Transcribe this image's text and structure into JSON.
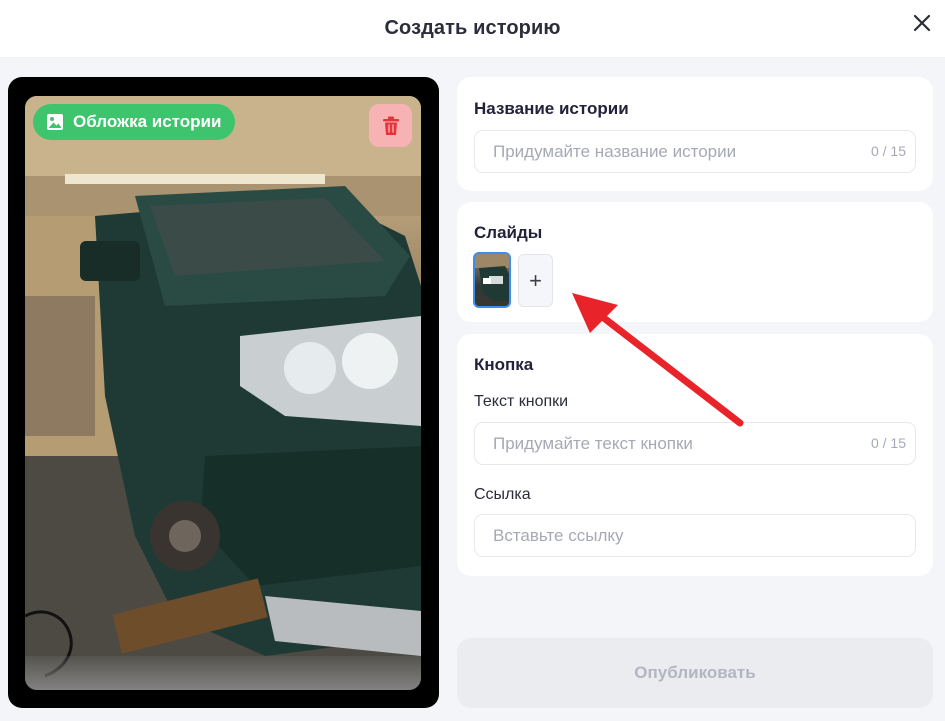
{
  "header": {
    "title": "Создать историю",
    "close_icon": "close-icon"
  },
  "preview": {
    "cover_label": "Обложка истории",
    "cover_icon": "image-icon",
    "delete_icon": "trash-icon",
    "accent_green": "#3ec46d",
    "delete_bg": "#f7b3b3"
  },
  "story_name": {
    "title": "Название истории",
    "placeholder": "Придумайте название истории",
    "counter": "0 / 15"
  },
  "slides": {
    "title": "Слайды",
    "add_label": "+",
    "selected_border": "#3b8ef0"
  },
  "button_section": {
    "title": "Кнопка",
    "text_label": "Текст кнопки",
    "text_placeholder": "Придумайте текст кнопки",
    "text_counter": "0 / 15",
    "link_label": "Ссылка",
    "link_placeholder": "Вставьте ссылку"
  },
  "publish": {
    "label": "Опубликовать"
  },
  "annotation": {
    "arrow_color": "#e8232a",
    "arrow_icon": "red-arrow-icon"
  }
}
